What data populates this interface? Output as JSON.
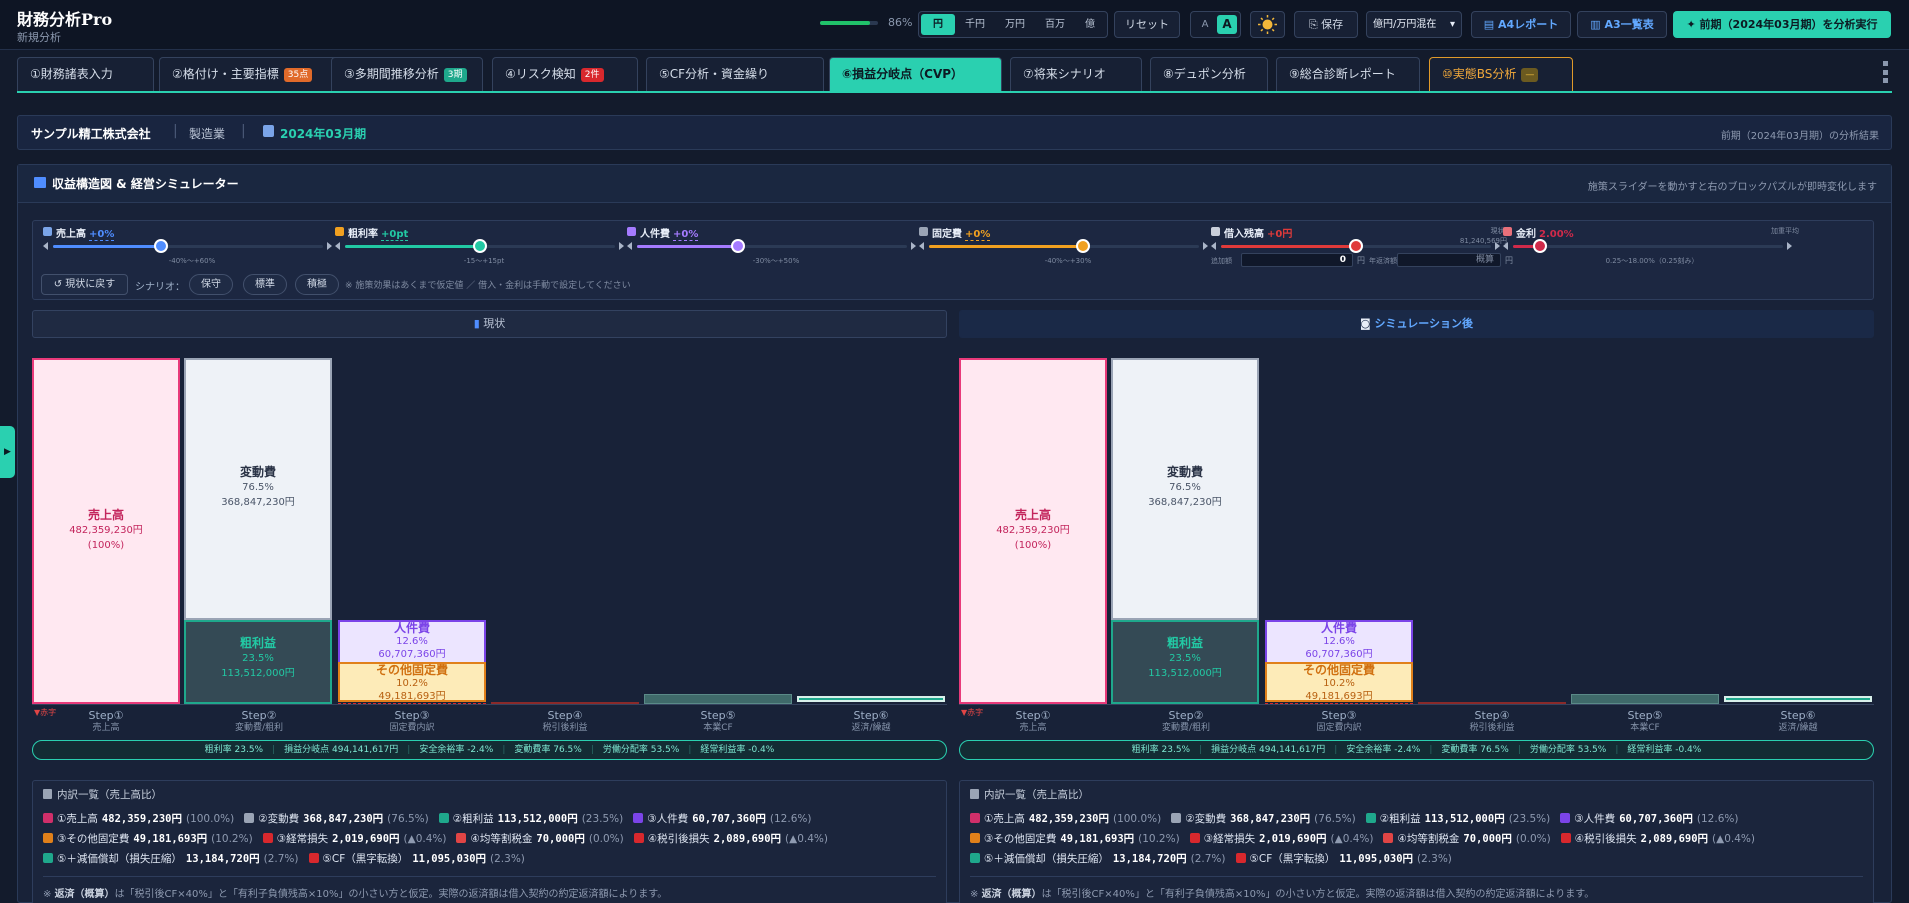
{
  "header": {
    "title": "財務分析Pro",
    "subtitle": "新規分析",
    "progress_pct": 86,
    "progress_text": "86%",
    "units": [
      "円",
      "千円",
      "万円",
      "百万",
      "億"
    ],
    "active_unit": "円",
    "reset": "リセット",
    "font_small": "A",
    "font_large": "A",
    "theme_icon": "sun-icon",
    "save": "保存",
    "unit_select": "億円/万円混在",
    "a4": "A4レポート",
    "a3": "A3一覧表",
    "run": "前期（2024年03月期）を分析実行"
  },
  "tabs": [
    {
      "label": "①財務諸表入力",
      "badge": ""
    },
    {
      "label": "②格付け・主要指標",
      "badge": "35点"
    },
    {
      "label": "③多期間推移分析",
      "badge": "3期"
    },
    {
      "label": "④リスク検知",
      "badge": "2件"
    },
    {
      "label": "⑤CF分析・資金繰り",
      "badge": ""
    },
    {
      "label": "⑥損益分岐点（CVP）",
      "badge": ""
    },
    {
      "label": "⑦将来シナリオ",
      "badge": ""
    },
    {
      "label": "⑧デュポン分析",
      "badge": ""
    },
    {
      "label": "⑨総合診断レポート",
      "badge": ""
    },
    {
      "label": "⑩実態BS分析",
      "badge": "—"
    }
  ],
  "company": {
    "name": "サンプル精工株式会社",
    "industry": "製造業",
    "period": "2024年03月期",
    "result_note": "前期（2024年03月期）の分析結果"
  },
  "panel": {
    "title": "収益構造図 & 経営シミュレーター",
    "hint": "施策スライダーを動かすと右のブロックパズルが即時変化します"
  },
  "sliders": [
    {
      "label": "売上高",
      "value": "+0%",
      "range": "-40%〜+60%",
      "color": "#4f8dff",
      "pos": 0.4
    },
    {
      "label": "粗利率",
      "value": "+0pt",
      "range": "-15〜+15pt",
      "color": "#22c9a4",
      "pos": 0.5
    },
    {
      "label": "人件費",
      "value": "+0%",
      "range": "-30%〜+50%",
      "color": "#a57bff",
      "pos": 0.375
    },
    {
      "label": "固定費",
      "value": "+0%",
      "range": "-40%〜+30%",
      "color": "#f0a020",
      "pos": 0.571
    },
    {
      "label": "借入残高",
      "value": "+0円",
      "range": "",
      "color": "#e03a3a",
      "pos": 0.5,
      "extra": "現状: 81,240,569円",
      "f1": "追加額",
      "f1v": "0",
      "f2": "年返済額",
      "f2p": "概算",
      "unit": "円"
    },
    {
      "label": "金利",
      "value": "2.00%",
      "range": "0.25〜18.00%（0.25刻み）",
      "color": "#d02a4a",
      "pos": 0.1,
      "extra": "加重平均"
    }
  ],
  "controls": {
    "reset": "現状に戻す",
    "scenario_label": "シナリオ：",
    "scenarios": [
      "保守",
      "標準",
      "積極"
    ],
    "note": "※ 施策効果はあくまで仮定値 ／ 借入・金利は手動で設定してください"
  },
  "columns": [
    {
      "title": "現状",
      "icon": "chart-icon"
    },
    {
      "title": "シミュレーション後",
      "icon": "robot-icon"
    }
  ],
  "bars": {
    "sales": {
      "label": "売上高",
      "pct": "482,359,230円",
      "sub": "(100%)"
    },
    "variable": {
      "label": "変動費",
      "pct": "76.5%",
      "amt": "368,847,230円"
    },
    "gross": {
      "label": "粗利益",
      "pct": "23.5%",
      "amt": "113,512,000円"
    },
    "labor": {
      "label": "人件費",
      "pct": "12.6%",
      "amt": "60,707,360円"
    },
    "other": {
      "label": "その他固定費",
      "pct": "10.2%",
      "amt": "49,181,693円"
    },
    "deficit": "▼赤字"
  },
  "steps": [
    {
      "s": "Step①",
      "t": "売上高"
    },
    {
      "s": "Step②",
      "t": "変動費/粗利"
    },
    {
      "s": "Step③",
      "t": "固定費内訳"
    },
    {
      "s": "Step④",
      "t": "税引後利益"
    },
    {
      "s": "Step⑤",
      "t": "本業CF"
    },
    {
      "s": "Step⑥",
      "t": "返済/繰越"
    }
  ],
  "metrics": [
    "粗利率 23.5%",
    "損益分岐点 494,141,617円",
    "安全余裕率 -2.4%",
    "変動費率 76.5%",
    "労働分配率 53.5%",
    "経常利益率 -0.4%"
  ],
  "breakdown": {
    "title": "内訳一覧（売上高比）",
    "rows": [
      [
        {
          "c": "#d02f6a",
          "l": "①売上高",
          "v": "482,359,230円",
          "p": "(100.0%)"
        },
        {
          "c": "#9aa4b5",
          "l": "②変動費",
          "v": "368,847,230円",
          "p": "(76.5%)"
        },
        {
          "c": "#1fa88c",
          "l": "②粗利益",
          "v": "113,512,000円",
          "p": "(23.5%)"
        },
        {
          "c": "#7b44e8",
          "l": "③人件費",
          "v": "60,707,360円",
          "p": "(12.6%)"
        }
      ],
      [
        {
          "c": "#e0801a",
          "l": "③その他固定費",
          "v": "49,181,693円",
          "p": "(10.2%)"
        },
        {
          "c": "#d8282d",
          "l": "③経常損失",
          "v": "2,019,690円",
          "p": "(▲0.4%)"
        },
        {
          "c": "#e04545",
          "l": "④均等割税金",
          "v": "70,000円",
          "p": "(0.0%)"
        },
        {
          "c": "#d8282d",
          "l": "④税引後損失",
          "v": "2,089,690円",
          "p": "(▲0.4%)"
        }
      ],
      [
        {
          "c": "#1fa88c",
          "l": "⑤＋減価償却（損失圧縮）",
          "v": "13,184,720円",
          "p": "(2.7%)"
        },
        {
          "c": "#d8282d",
          "l": "⑤CF（黒字転換）",
          "v": "11,095,030円",
          "p": "(2.3%)"
        }
      ]
    ],
    "note_b": "返済（概算）",
    "note": "は「税引後CF×40%」と「有利子負債残高×10%」の小さい方と仮定。実際の返済額は借入契約の約定返済額によります。"
  }
}
